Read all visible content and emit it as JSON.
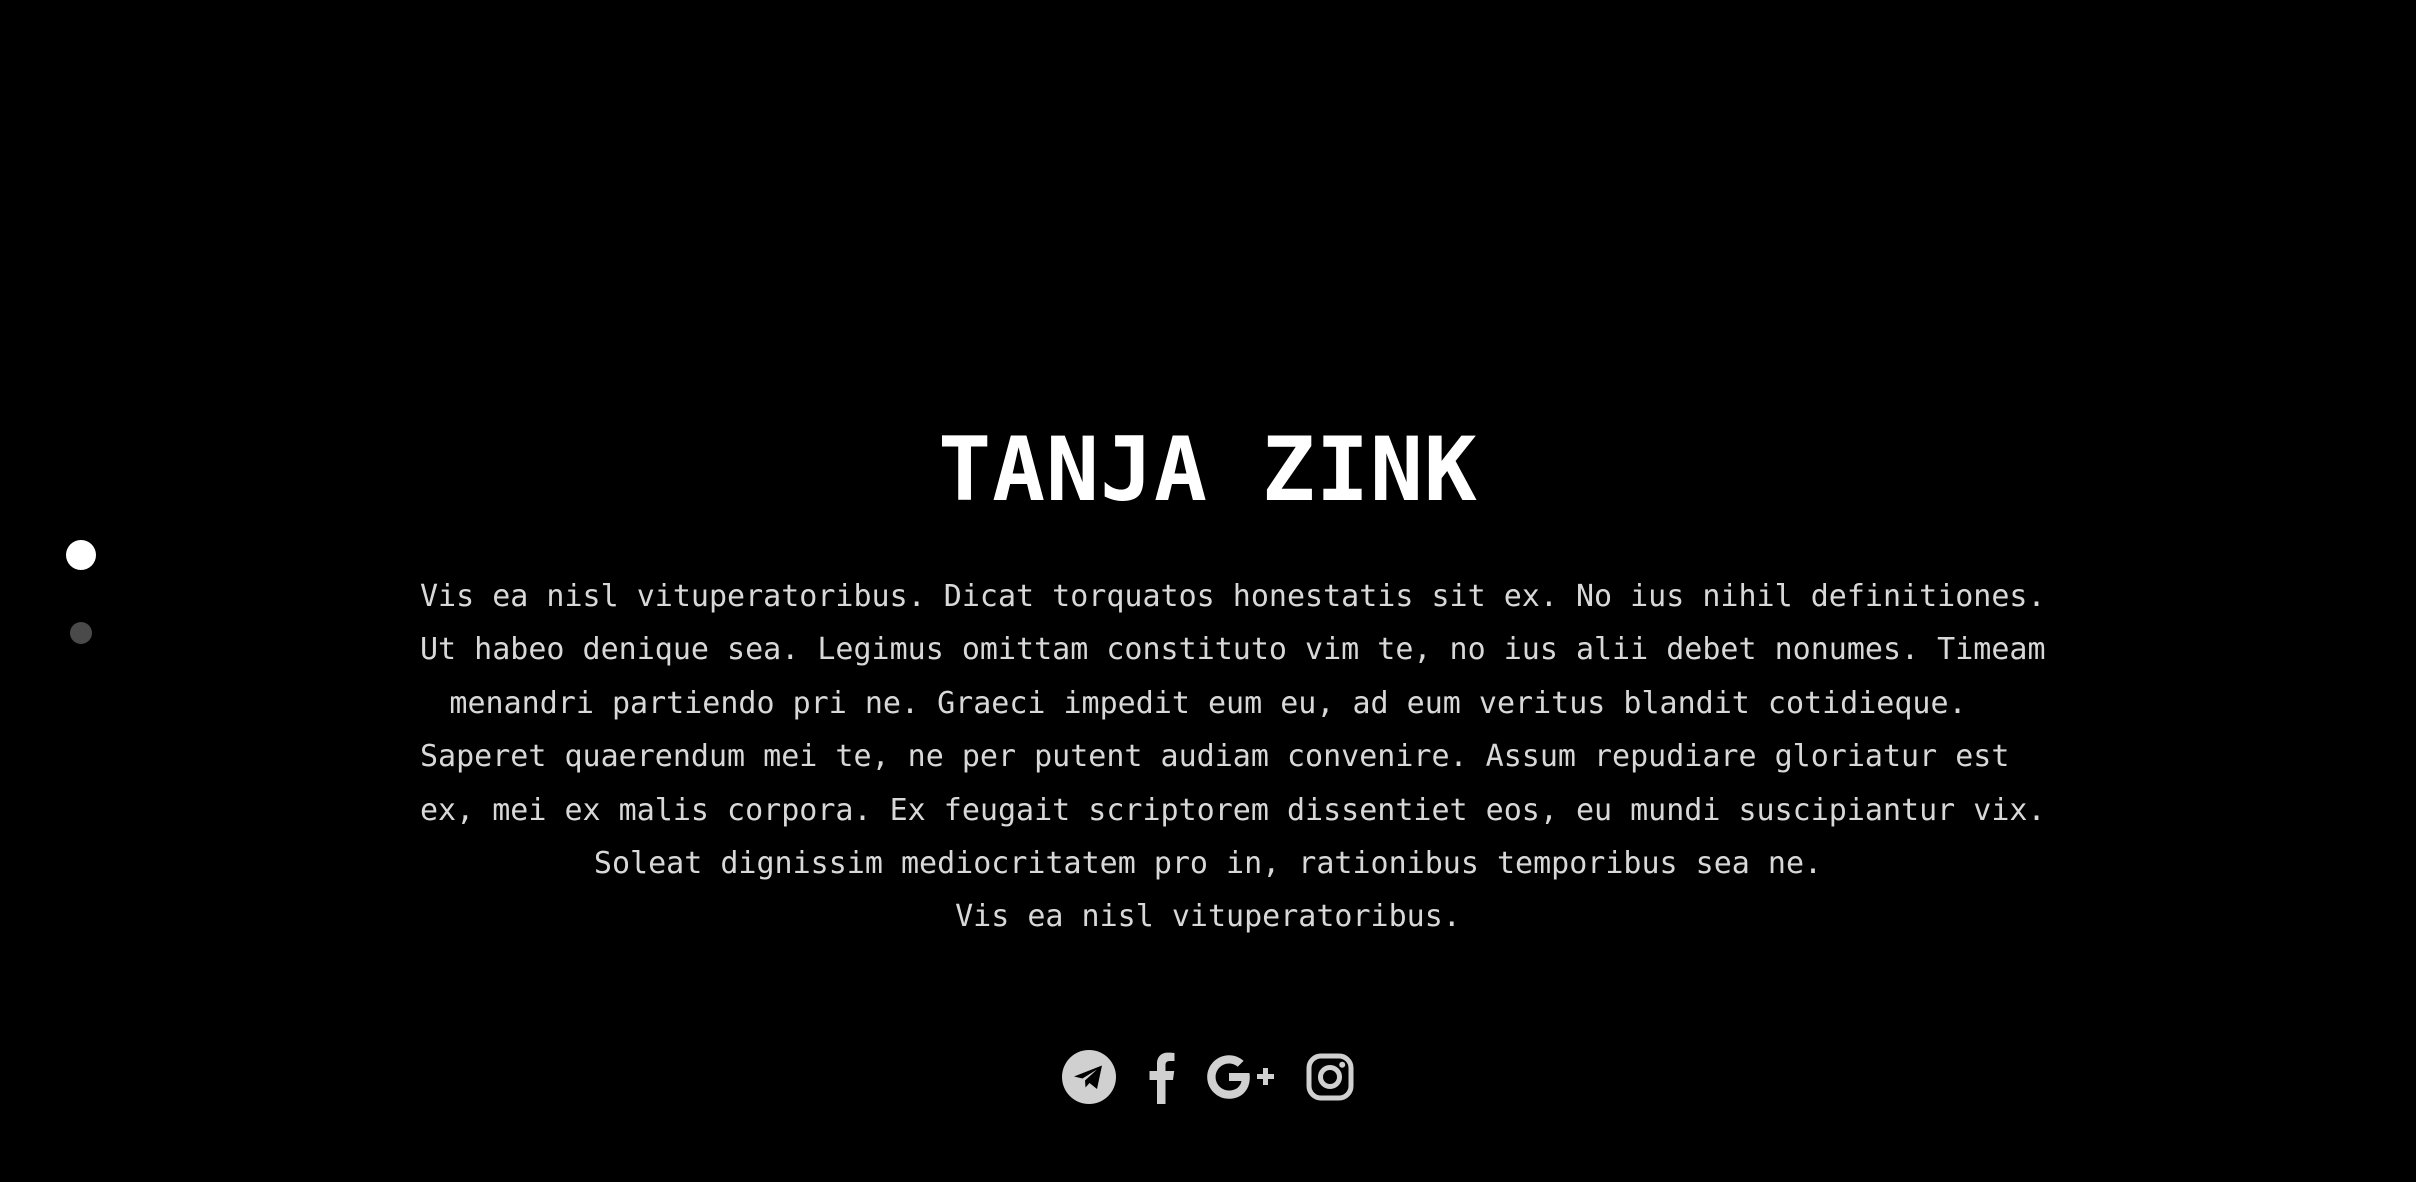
{
  "page_nav": {
    "slides": [
      {
        "name": "slide-1",
        "active": true
      },
      {
        "name": "slide-2",
        "active": false
      }
    ]
  },
  "hero": {
    "title": "TANJA ZINK",
    "text_lines": [
      "Vis ea nisl vituperatoribus. Dicat torquatos honestatis sit ex. No ius nihil definitiones.",
      "Ut habeo denique sea. Legimus omittam constituto vim te, no ius alii debet nonumes. Timeam",
      "menandri partiendo pri ne. Graeci impedit eum eu, ad eum veritus blandit cotidieque.",
      "Saperet quaerendum mei te, ne per putent audiam convenire. Assum repudiare gloriatur est",
      "ex, mei ex malis corpora. Ex feugait scriptorem dissentiet eos, eu mundi suscipiantur vix.",
      "Soleat dignissim mediocritatem pro in, rationibus temporibus sea ne.",
      "Vis ea nisl vituperatoribus."
    ]
  },
  "social": {
    "icons": [
      "telegram-icon",
      "facebook-icon",
      "google-plus-icon",
      "instagram-icon"
    ],
    "icon_color": "#d0d0d0"
  },
  "colors": {
    "background": "#000000",
    "title": "#ffffff",
    "text": "#d8d8d8",
    "dot_active": "#ffffff",
    "dot_inactive": "#4a4a4a"
  }
}
